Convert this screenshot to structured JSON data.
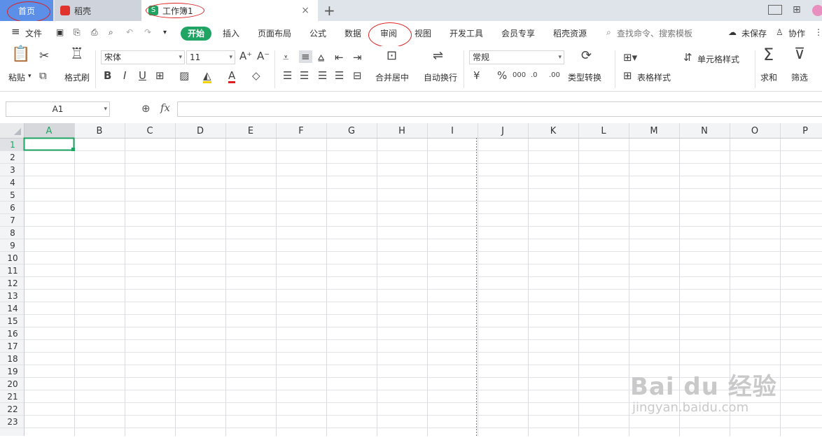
{
  "tabs": {
    "home": "首页",
    "daoke": "稻壳",
    "workbook": "工作簿1",
    "close": "×",
    "add": "+"
  },
  "menu": {
    "file": "文件",
    "start": "开始",
    "insert": "插入",
    "page_layout": "页面布局",
    "formula": "公式",
    "data": "数据",
    "review": "审阅",
    "view": "视图",
    "dev_tools": "开发工具",
    "member": "会员专享",
    "daoke_res": "稻壳资源",
    "search_placeholder": "查找命令、搜索模板",
    "unsaved": "未保存",
    "collab": "协作"
  },
  "ribbon": {
    "paste": "粘贴",
    "format_painter": "格式刷",
    "font_name": "宋体",
    "font_size": "11",
    "merge_center": "合并居中",
    "wrap_text": "自动换行",
    "number_format": "常规",
    "type_convert": "类型转换",
    "cell_style": "单元格样式",
    "table_style": "表格样式",
    "sum": "求和",
    "filter": "筛选"
  },
  "formula_bar": {
    "name_box": "A1",
    "fx": "fx"
  },
  "sheet": {
    "columns": [
      "A",
      "B",
      "C",
      "D",
      "E",
      "F",
      "G",
      "H",
      "I",
      "J",
      "K",
      "L",
      "M",
      "N",
      "O",
      "P"
    ],
    "rows": [
      "1",
      "2",
      "3",
      "4",
      "5",
      "6",
      "7",
      "8",
      "9",
      "10",
      "11",
      "12",
      "13",
      "14",
      "15",
      "16",
      "17",
      "18",
      "19",
      "20",
      "21",
      "22",
      "23"
    ],
    "selected_cell": "A1"
  },
  "watermark": {
    "brand": "Bai du 经验",
    "url": "jingyan.baidu.com"
  },
  "colors": {
    "accent_green": "#1fa463",
    "home_tab": "#5b8fe8",
    "annotation_red": "#d22222"
  }
}
